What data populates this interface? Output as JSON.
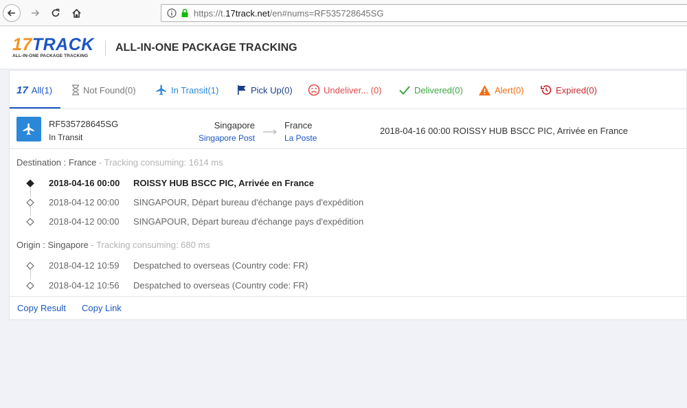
{
  "browser": {
    "url_prefix": "https://t.",
    "url_domain": "17track.net",
    "url_suffix": "/en#nums=RF535728645SG"
  },
  "header": {
    "logo_number": "17",
    "logo_text": "TRACK",
    "logo_tagline": "ALL-IN-ONE PACKAGE TRACKING",
    "title": "ALL-IN-ONE PACKAGE TRACKING"
  },
  "tabs": [
    {
      "label": "All(1)",
      "icon": "17-logo-icon"
    },
    {
      "label": "Not Found(0)",
      "icon": "hourglass-icon"
    },
    {
      "label": "In Transit(1)",
      "icon": "airplane-icon"
    },
    {
      "label": "Pick Up(0)",
      "icon": "flag-icon"
    },
    {
      "label": "Undeliver... (0)",
      "icon": "sad-face-icon"
    },
    {
      "label": "Delivered(0)",
      "icon": "check-icon"
    },
    {
      "label": "Alert(0)",
      "icon": "warning-icon"
    },
    {
      "label": "Expired(0)",
      "icon": "history-icon"
    }
  ],
  "package": {
    "number": "RF535728645SG",
    "status": "In Transit",
    "origin_country": "Singapore",
    "origin_carrier": "Singapore Post",
    "dest_country": "France",
    "dest_carrier": "La Poste",
    "latest_event": "2018-04-16 00:00  ROISSY HUB BSCC PIC, Arrivée en France"
  },
  "destination": {
    "label": "Destination : France",
    "meta": " - Tracking consuming: 1614 ms",
    "events": [
      {
        "time": "2018-04-16 00:00",
        "desc": "ROISSY HUB BSCC PIC, Arrivée en France"
      },
      {
        "time": "2018-04-12 00:00",
        "desc": "SINGAPOUR, Départ bureau d'échange pays d'expédition"
      },
      {
        "time": "2018-04-12 00:00",
        "desc": "SINGAPOUR, Départ bureau d'échange pays d'expédition"
      }
    ]
  },
  "origin": {
    "label": "Origin : Singapore",
    "meta": " - Tracking consuming: 680 ms",
    "events": [
      {
        "time": "2018-04-12 10:59",
        "desc": "Despatched to overseas (Country code: FR)"
      },
      {
        "time": "2018-04-12 10:56",
        "desc": "Despatched to overseas (Country code: FR)"
      }
    ]
  },
  "actions": {
    "copy_result": "Copy Result",
    "copy_link": "Copy Link"
  },
  "colors": {
    "brand_blue": "#1a56c4",
    "brand_orange": "#f7931e",
    "transit_blue": "#2b87d8"
  }
}
